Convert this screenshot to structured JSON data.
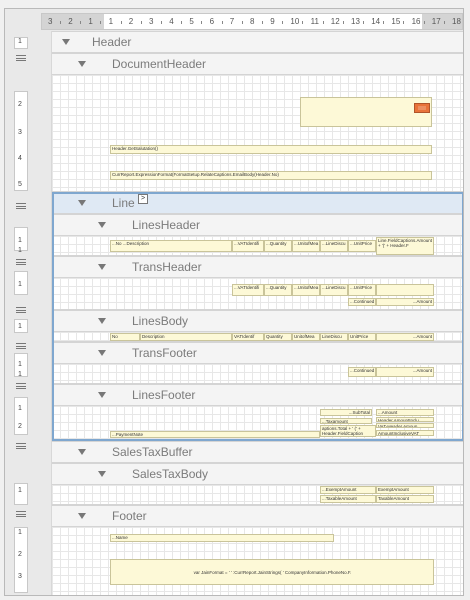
{
  "ruler": {
    "horizontal_ticks": [
      "3",
      "2",
      "1",
      "1",
      "2",
      "3",
      "4",
      "5",
      "6",
      "7",
      "8",
      "9",
      "10",
      "11",
      "12",
      "13",
      "14",
      "15",
      "16",
      "17",
      "18"
    ],
    "vertical_numbers": [
      "1",
      "2",
      "3",
      "4",
      "5",
      "1",
      "1",
      "1",
      "1",
      "1",
      "1",
      "1",
      "2",
      "1",
      "1",
      "2",
      "3"
    ]
  },
  "bands": {
    "header": "Header",
    "document_header": "DocumentHeader",
    "line": "Line",
    "lines_header": "LinesHeader",
    "trans_header": "TransHeader",
    "lines_body": "LinesBody",
    "trans_footer": "TransFooter",
    "lines_footer": "LinesFooter",
    "sales_tax_buffer": "SalesTaxBuffer",
    "sales_tax_body": "SalesTaxBody",
    "footer": "Footer"
  },
  "fields": {
    "salutation": "Header.GetSalutation()",
    "caption_expr": "CurrReport.ExpressionFormat(FormatSetup.RelateCaptions.EmailBody(Header.No)",
    "lh_no": "...No",
    "lh_description": "...Description",
    "lh_vat": "...VATIdentifi",
    "lh_quantity": "...Quantity",
    "lh_unitofmea": "...UnitofMea",
    "lh_linedisc": "...LineDiscu",
    "lh_unitprice": "...UnitPrice",
    "lh_amount_caption": "Line.FieldCaptions.Amount + '(' + Header.F",
    "th_vat": "...VATIdentifi",
    "th_quantity": "...Quantity",
    "th_unitofmea": "...UnitofMea",
    "th_linedisc": "...LineDiscu",
    "th_unitprice": "...UnitPrice",
    "th_continued": "...Continued",
    "th_amount": "...Amount",
    "lb_no": "No",
    "lb_description": "Description",
    "lb_vat": "VATIdentif",
    "lb_quantity": "Quantity",
    "lb_unitofmea": "UnitofMea",
    "lb_linedisc": "LineDiscu",
    "lb_unitprice": "UnitPrice",
    "lb_amount": "...Amount",
    "tf_continued": "...Continued",
    "tf_amount": "...Amount",
    "lf_subtotal": "...SubTotal",
    "lf_amount": "...Amount",
    "lf_taxamount": "...Taxamount",
    "lf_header_amount": "Header.AmountInclu",
    "lf_vat_header": "VAT-Header.Amoun",
    "lf_caption_total": "aptions.Total + ' (' + Header.FieldCaption",
    "lf_amount_incl": "AmountInclusiveVAT",
    "lf_payment": "...PaymentNote",
    "st_exempt": "...ExemptAmount",
    "st_exempt_val": "ExemptAmount",
    "st_taxable": "...TaxableAmount",
    "st_taxable_val": "TaxableAmount",
    "ft_name": "...Name",
    "ft_expr": "var JainFormat = ' ' :CurrReport.JainStrings( ' CompanyInformation.PhoneNo.F."
  },
  "expand_button": ">"
}
